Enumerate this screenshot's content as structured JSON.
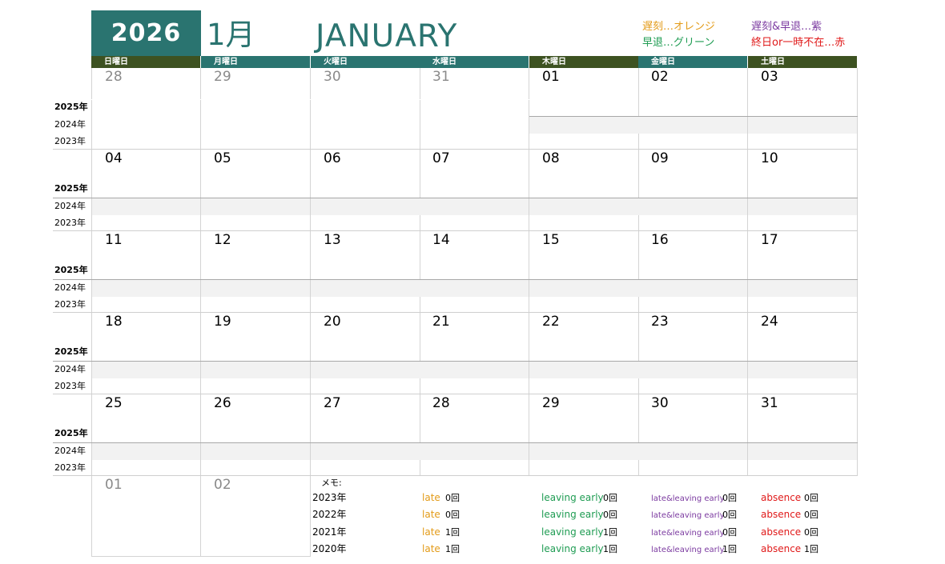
{
  "header": {
    "year": "2026",
    "month_jp": "1月",
    "month_en": "JANUARY"
  },
  "legend": [
    {
      "text": "遅刻…オレンジ",
      "color": "#e39b18"
    },
    {
      "text": "早退…グリーン",
      "color": "#1f9c53"
    },
    {
      "text": "遅刻&早退…紫",
      "color": "#7b3aa0"
    },
    {
      "text": "終日or一時不在…赤",
      "color": "#e01919"
    }
  ],
  "colors": {
    "teal": "#2a7470",
    "olive": "#3d5221"
  },
  "weekdays": [
    "日曜日",
    "月曜日",
    "火曜日",
    "水曜日",
    "木曜日",
    "金曜日",
    "土曜日"
  ],
  "weekday_colors": [
    "olive",
    "teal",
    "teal",
    "teal",
    "olive",
    "teal",
    "olive"
  ],
  "weeks": [
    [
      {
        "day": "28",
        "other": true
      },
      {
        "day": "29",
        "other": true
      },
      {
        "day": "30",
        "other": true
      },
      {
        "day": "31",
        "other": true
      },
      {
        "day": "01",
        "other": false
      },
      {
        "day": "02",
        "other": false
      },
      {
        "day": "03",
        "other": false
      }
    ],
    [
      {
        "day": "04",
        "other": false
      },
      {
        "day": "05",
        "other": false
      },
      {
        "day": "06",
        "other": false
      },
      {
        "day": "07",
        "other": false
      },
      {
        "day": "08",
        "other": false
      },
      {
        "day": "09",
        "other": false
      },
      {
        "day": "10",
        "other": false
      }
    ],
    [
      {
        "day": "11",
        "other": false
      },
      {
        "day": "12",
        "other": false
      },
      {
        "day": "13",
        "other": false
      },
      {
        "day": "14",
        "other": false
      },
      {
        "day": "15",
        "other": false
      },
      {
        "day": "16",
        "other": false
      },
      {
        "day": "17",
        "other": false
      }
    ],
    [
      {
        "day": "18",
        "other": false
      },
      {
        "day": "19",
        "other": false
      },
      {
        "day": "20",
        "other": false
      },
      {
        "day": "21",
        "other": false
      },
      {
        "day": "22",
        "other": false
      },
      {
        "day": "23",
        "other": false
      },
      {
        "day": "24",
        "other": false
      }
    ],
    [
      {
        "day": "25",
        "other": false
      },
      {
        "day": "26",
        "other": false
      },
      {
        "day": "27",
        "other": false
      },
      {
        "day": "28",
        "other": false
      },
      {
        "day": "29",
        "other": false
      },
      {
        "day": "30",
        "other": false
      },
      {
        "day": "31",
        "other": false
      }
    ]
  ],
  "extra_days": [
    {
      "day": "01",
      "other": true
    },
    {
      "day": "02",
      "other": true
    }
  ],
  "year_labels": [
    "2025年",
    "2024年",
    "2023年"
  ],
  "memo_label": "メモ:",
  "stat_types": [
    {
      "label": "late",
      "color": "#e39b18"
    },
    {
      "label": "leaving early",
      "color": "#1f9c53"
    },
    {
      "label": "late&leaving early",
      "color": "#7b3aa0"
    },
    {
      "label": "absence",
      "color": "#e01919"
    }
  ],
  "stats": [
    {
      "year": "2023年",
      "counts": [
        "0回",
        "0回",
        "0回",
        "0回"
      ]
    },
    {
      "year": "2022年",
      "counts": [
        "0回",
        "0回",
        "0回",
        "0回"
      ]
    },
    {
      "year": "2021年",
      "counts": [
        "1回",
        "1回",
        "0回",
        "0回"
      ]
    },
    {
      "year": "2020年",
      "counts": [
        "1回",
        "1回",
        "1回",
        "1回"
      ]
    }
  ]
}
